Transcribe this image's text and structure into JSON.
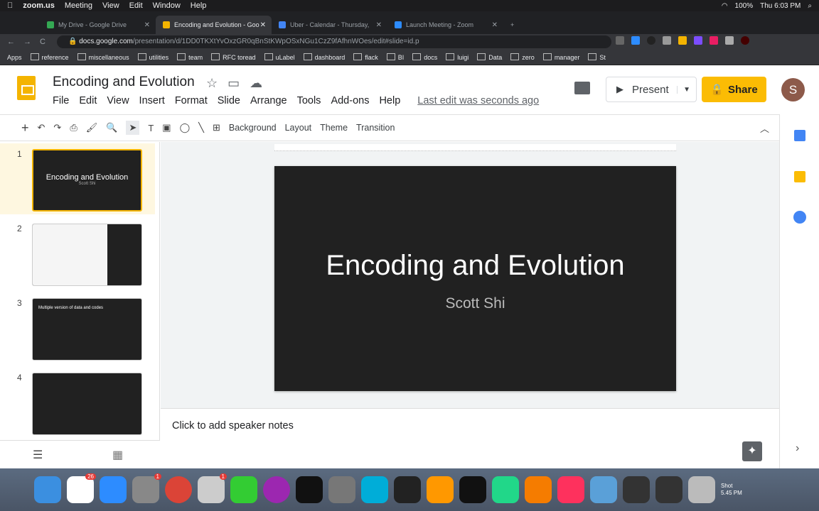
{
  "menubar": {
    "app": "zoom.us",
    "items": [
      "Meeting",
      "View",
      "Edit",
      "Window",
      "Help"
    ],
    "battery": "100%",
    "clock": "Thu 6:03 PM"
  },
  "tabs": [
    {
      "label": "My Drive - Google Drive",
      "color": "#34a853"
    },
    {
      "label": "Encoding and Evolution - Goo",
      "color": "#f4b400"
    },
    {
      "label": "Uber - Calendar - Thursday,",
      "color": "#4285f4"
    },
    {
      "label": "Launch Meeting - Zoom",
      "color": "#2d8cff"
    }
  ],
  "address": {
    "domain": "docs.google.com",
    "path": "/presentation/d/1DD0TKXtYvOxzGR0qBnStKWpOSxNGu1CzZ9fAfhnWOes/edit#slide=id.p"
  },
  "bookmarks": [
    "Apps",
    "reference",
    "miscellaneous",
    "utilities",
    "team",
    "RFC toread",
    "uLabel",
    "dashboard",
    "flack",
    "BI",
    "docs",
    "luigi",
    "Data",
    "zero",
    "manager",
    "St"
  ],
  "doc": {
    "title": "Encoding and Evolution",
    "menus": [
      "File",
      "Edit",
      "View",
      "Insert",
      "Format",
      "Slide",
      "Arrange",
      "Tools",
      "Add-ons",
      "Help"
    ],
    "last_edit": "Last edit was seconds ago",
    "present": "Present",
    "share": "Share",
    "avatar": "S"
  },
  "toolbar": {
    "background": "Background",
    "layout": "Layout",
    "theme": "Theme",
    "transition": "Transition"
  },
  "slides": [
    {
      "num": "1",
      "title": "Encoding and Evolution",
      "subtitle": "Scott Shi"
    },
    {
      "num": "2",
      "title": "",
      "subtitle": ""
    },
    {
      "num": "3",
      "title": "Multiple version of data and codes",
      "subtitle": ""
    },
    {
      "num": "4",
      "title": "",
      "subtitle": ""
    }
  ],
  "current_slide": {
    "title": "Encoding and Evolution",
    "subtitle": "Scott Shi"
  },
  "notes_placeholder": "Click to add speaker notes",
  "dock": {
    "slack_badge": "26",
    "settings_badge": "1",
    "other_badge": "1",
    "screenshot_label": "Shot",
    "screenshot_time": "5.45 PM"
  }
}
